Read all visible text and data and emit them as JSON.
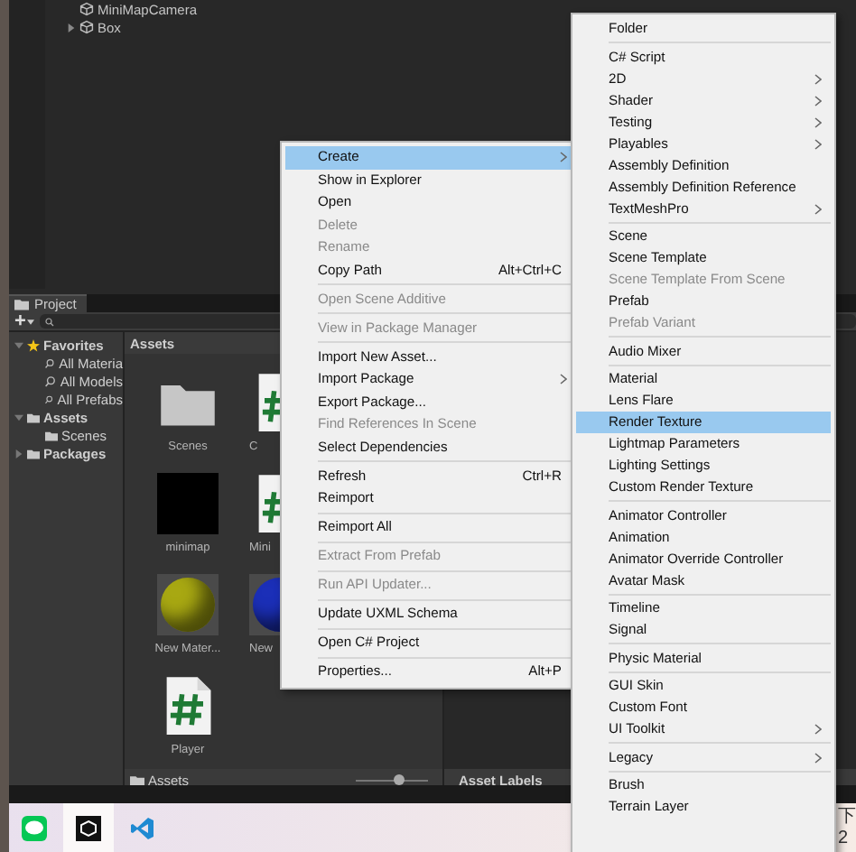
{
  "hierarchy": {
    "items": [
      {
        "label": "MiniMapCamera",
        "has_children": false
      },
      {
        "label": "Box",
        "has_children": true
      }
    ]
  },
  "project": {
    "tab": "Project",
    "toolbar": {
      "add": "+"
    },
    "tree": [
      {
        "label": "Favorites",
        "kind": "favorites",
        "expanded": true,
        "children": [
          {
            "label": "All Materia",
            "kind": "search"
          },
          {
            "label": "All Models",
            "kind": "search"
          },
          {
            "label": "All Prefabs",
            "kind": "search"
          }
        ]
      },
      {
        "label": "Assets",
        "kind": "folder",
        "expanded": true,
        "children": [
          {
            "label": "Scenes",
            "kind": "folder"
          }
        ]
      },
      {
        "label": "Packages",
        "kind": "folder",
        "expanded": false
      }
    ],
    "grid_title": "Assets",
    "grid_items": [
      {
        "label": "Scenes",
        "kind": "folder"
      },
      {
        "label": "C",
        "kind": "script"
      },
      {
        "label": "minimap",
        "kind": "texture"
      },
      {
        "label": "Mini",
        "kind": "script"
      },
      {
        "label": "New Mater...",
        "kind": "sphere",
        "color": "#a8a812"
      },
      {
        "label": "New",
        "kind": "sphere",
        "color": "#1b2fb8"
      },
      {
        "label": "Player",
        "kind": "script"
      }
    ],
    "path": "Assets",
    "zoom": {
      "level": 0.6
    },
    "labels_title": "Asset Labels"
  },
  "context_menu": {
    "items": [
      {
        "kind": "item",
        "label": "Create",
        "submenu": true,
        "disabled": false,
        "selected": true
      },
      {
        "kind": "item",
        "label": "Show in Explorer",
        "disabled": false,
        "selected": false
      },
      {
        "kind": "item",
        "label": "Open",
        "disabled": false,
        "selected": false
      },
      {
        "kind": "item",
        "label": "Delete",
        "disabled": true,
        "selected": false
      },
      {
        "kind": "item",
        "label": "Rename",
        "disabled": true,
        "selected": false
      },
      {
        "kind": "item",
        "label": "Copy Path",
        "shortcut": "Alt+Ctrl+C",
        "disabled": false,
        "selected": false
      },
      {
        "kind": "separator"
      },
      {
        "kind": "item",
        "label": "Open Scene Additive",
        "disabled": true,
        "selected": false
      },
      {
        "kind": "separator"
      },
      {
        "kind": "item",
        "label": "View in Package Manager",
        "disabled": true,
        "selected": false
      },
      {
        "kind": "separator"
      },
      {
        "kind": "item",
        "label": "Import New Asset...",
        "disabled": false,
        "selected": false
      },
      {
        "kind": "item",
        "label": "Import Package",
        "submenu": true,
        "disabled": false,
        "selected": false
      },
      {
        "kind": "item",
        "label": "Export Package...",
        "disabled": false,
        "selected": false
      },
      {
        "kind": "item",
        "label": "Find References In Scene",
        "disabled": true,
        "selected": false
      },
      {
        "kind": "item",
        "label": "Select Dependencies",
        "disabled": false,
        "selected": false
      },
      {
        "kind": "separator"
      },
      {
        "kind": "item",
        "label": "Refresh",
        "shortcut": "Ctrl+R",
        "disabled": false,
        "selected": false
      },
      {
        "kind": "item",
        "label": "Reimport",
        "disabled": false,
        "selected": false
      },
      {
        "kind": "separator"
      },
      {
        "kind": "item",
        "label": "Reimport All",
        "disabled": false,
        "selected": false
      },
      {
        "kind": "separator"
      },
      {
        "kind": "item",
        "label": "Extract From Prefab",
        "disabled": true,
        "selected": false
      },
      {
        "kind": "separator"
      },
      {
        "kind": "item",
        "label": "Run API Updater...",
        "disabled": true,
        "selected": false
      },
      {
        "kind": "separator"
      },
      {
        "kind": "item",
        "label": "Update UXML Schema",
        "disabled": false,
        "selected": false
      },
      {
        "kind": "separator"
      },
      {
        "kind": "item",
        "label": "Open C# Project",
        "disabled": false,
        "selected": false
      },
      {
        "kind": "separator"
      },
      {
        "kind": "item",
        "label": "Properties...",
        "shortcut": "Alt+P",
        "disabled": false,
        "selected": false
      }
    ]
  },
  "create_submenu": {
    "items": [
      {
        "kind": "item",
        "label": "Folder",
        "disabled": false,
        "selected": false
      },
      {
        "kind": "separator"
      },
      {
        "kind": "item",
        "label": "C# Script",
        "disabled": false,
        "selected": false
      },
      {
        "kind": "item",
        "label": "2D",
        "submenu": true,
        "disabled": false,
        "selected": false
      },
      {
        "kind": "item",
        "label": "Shader",
        "submenu": true,
        "disabled": false,
        "selected": false
      },
      {
        "kind": "item",
        "label": "Testing",
        "submenu": true,
        "disabled": false,
        "selected": false
      },
      {
        "kind": "item",
        "label": "Playables",
        "submenu": true,
        "disabled": false,
        "selected": false
      },
      {
        "kind": "item",
        "label": "Assembly Definition",
        "disabled": false,
        "selected": false
      },
      {
        "kind": "item",
        "label": "Assembly Definition Reference",
        "disabled": false,
        "selected": false
      },
      {
        "kind": "item",
        "label": "TextMeshPro",
        "submenu": true,
        "disabled": false,
        "selected": false
      },
      {
        "kind": "separator"
      },
      {
        "kind": "item",
        "label": "Scene",
        "disabled": false,
        "selected": false
      },
      {
        "kind": "item",
        "label": "Scene Template",
        "disabled": false,
        "selected": false
      },
      {
        "kind": "item",
        "label": "Scene Template From Scene",
        "disabled": true,
        "selected": false
      },
      {
        "kind": "item",
        "label": "Prefab",
        "disabled": false,
        "selected": false
      },
      {
        "kind": "item",
        "label": "Prefab Variant",
        "disabled": true,
        "selected": false
      },
      {
        "kind": "separator"
      },
      {
        "kind": "item",
        "label": "Audio Mixer",
        "disabled": false,
        "selected": false
      },
      {
        "kind": "separator"
      },
      {
        "kind": "item",
        "label": "Material",
        "disabled": false,
        "selected": false
      },
      {
        "kind": "item",
        "label": "Lens Flare",
        "disabled": false,
        "selected": false
      },
      {
        "kind": "item",
        "label": "Render Texture",
        "disabled": false,
        "selected": true
      },
      {
        "kind": "item",
        "label": "Lightmap Parameters",
        "disabled": false,
        "selected": false
      },
      {
        "kind": "item",
        "label": "Lighting Settings",
        "disabled": false,
        "selected": false
      },
      {
        "kind": "item",
        "label": "Custom Render Texture",
        "disabled": false,
        "selected": false
      },
      {
        "kind": "separator"
      },
      {
        "kind": "item",
        "label": "Animator Controller",
        "disabled": false,
        "selected": false
      },
      {
        "kind": "item",
        "label": "Animation",
        "disabled": false,
        "selected": false
      },
      {
        "kind": "item",
        "label": "Animator Override Controller",
        "disabled": false,
        "selected": false
      },
      {
        "kind": "item",
        "label": "Avatar Mask",
        "disabled": false,
        "selected": false
      },
      {
        "kind": "separator"
      },
      {
        "kind": "item",
        "label": "Timeline",
        "disabled": false,
        "selected": false
      },
      {
        "kind": "item",
        "label": "Signal",
        "disabled": false,
        "selected": false
      },
      {
        "kind": "separator"
      },
      {
        "kind": "item",
        "label": "Physic Material",
        "disabled": false,
        "selected": false
      },
      {
        "kind": "separator"
      },
      {
        "kind": "item",
        "label": "GUI Skin",
        "disabled": false,
        "selected": false
      },
      {
        "kind": "item",
        "label": "Custom Font",
        "disabled": false,
        "selected": false
      },
      {
        "kind": "item",
        "label": "UI Toolkit",
        "submenu": true,
        "disabled": false,
        "selected": false
      },
      {
        "kind": "separator"
      },
      {
        "kind": "item",
        "label": "Legacy",
        "submenu": true,
        "disabled": false,
        "selected": false
      },
      {
        "kind": "separator"
      },
      {
        "kind": "item",
        "label": "Brush",
        "disabled": false,
        "selected": false
      },
      {
        "kind": "item",
        "label": "Terrain Layer",
        "disabled": false,
        "selected": false
      }
    ]
  },
  "taskbar": {
    "apps": [
      {
        "kind": "line",
        "selected": false
      },
      {
        "kind": "unity",
        "selected": true
      },
      {
        "kind": "vscode",
        "selected": false
      }
    ],
    "tray": [
      "下",
      "2"
    ]
  }
}
